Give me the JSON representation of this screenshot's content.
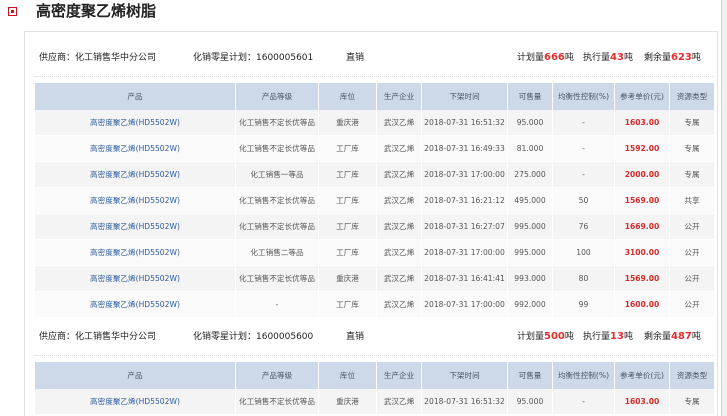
{
  "page": {
    "title": "高密度聚乙烯树脂"
  },
  "columns": [
    "产品",
    "产品等级",
    "库位",
    "生产企业",
    "下架时间",
    "可售量",
    "均衡性控制(%)",
    "参考单价(元)",
    "资源类型"
  ],
  "sections": [
    {
      "supplier_label": "供应商：化工销售华中分公司",
      "plan_label": "化销零星计划：1600005601",
      "mode": "直销",
      "plan_qty_label": "计划量",
      "plan_qty": "666",
      "plan_qty_unit": "吨",
      "exec_qty_label": "执行量",
      "exec_qty": "43",
      "exec_qty_unit": "吨",
      "rem_qty_label": "剩余量",
      "rem_qty": "623",
      "rem_qty_unit": "吨",
      "rows": [
        {
          "product": "高密度聚乙烯(HD5502W)",
          "grade": "化工销售不定长优等品",
          "location": "重庆港",
          "maker": "武汉乙烯",
          "time": "2018-07-31 16:51:32",
          "qty": "95.000",
          "ratio": "-",
          "price": "1603.00",
          "type": "专属"
        },
        {
          "product": "高密度聚乙烯(HD5502W)",
          "grade": "化工销售不定长优等品",
          "location": "工厂库",
          "maker": "武汉乙烯",
          "time": "2018-07-31 16:49:33",
          "qty": "81.000",
          "ratio": "-",
          "price": "1592.00",
          "type": "专属"
        },
        {
          "product": "高密度聚乙烯(HD5502W)",
          "grade": "化工销售一等品",
          "location": "工厂库",
          "maker": "武汉乙烯",
          "time": "2018-07-31 17:00:00",
          "qty": "275.000",
          "ratio": "-",
          "price": "2000.00",
          "type": "专属"
        },
        {
          "product": "高密度聚乙烯(HD5502W)",
          "grade": "化工销售不定长优等品",
          "location": "工厂库",
          "maker": "武汉乙烯",
          "time": "2018-07-31 16:21:12",
          "qty": "495.000",
          "ratio": "50",
          "price": "1569.00",
          "type": "共享"
        },
        {
          "product": "高密度聚乙烯(HD5502W)",
          "grade": "化工销售不定长优等品",
          "location": "工厂库",
          "maker": "武汉乙烯",
          "time": "2018-07-31 16:27:07",
          "qty": "995.000",
          "ratio": "76",
          "price": "1669.00",
          "type": "公开"
        },
        {
          "product": "高密度聚乙烯(HD5502W)",
          "grade": "化工销售二等品",
          "location": "工厂库",
          "maker": "武汉乙烯",
          "time": "2018-07-31 17:00:00",
          "qty": "995.000",
          "ratio": "100",
          "price": "3100.00",
          "type": "公开"
        },
        {
          "product": "高密度聚乙烯(HD5502W)",
          "grade": "化工销售不定长优等品",
          "location": "重庆港",
          "maker": "武汉乙烯",
          "time": "2018-07-31 16:41:41",
          "qty": "993.000",
          "ratio": "80",
          "price": "1569.00",
          "type": "公开"
        },
        {
          "product": "高密度聚乙烯(HD5502W)",
          "grade": "-",
          "location": "工厂库",
          "maker": "武汉乙烯",
          "time": "2018-07-31 17:00:00",
          "qty": "992.000",
          "ratio": "99",
          "price": "1600.00",
          "type": "公开"
        }
      ]
    },
    {
      "supplier_label": "供应商：化工销售华中分公司",
      "plan_label": "化销零星计划：1600005600",
      "mode": "直销",
      "plan_qty_label": "计划量",
      "plan_qty": "500",
      "plan_qty_unit": "吨",
      "exec_qty_label": "执行量",
      "exec_qty": "13",
      "exec_qty_unit": "吨",
      "rem_qty_label": "剩余量",
      "rem_qty": "487",
      "rem_qty_unit": "吨",
      "rows": [
        {
          "product": "高密度聚乙烯(HD5502W)",
          "grade": "化工销售不定长优等品",
          "location": "重庆港",
          "maker": "武汉乙烯",
          "time": "2018-07-31 16:51:32",
          "qty": "95.000",
          "ratio": "-",
          "price": "1603.00",
          "type": "专属"
        }
      ]
    }
  ]
}
